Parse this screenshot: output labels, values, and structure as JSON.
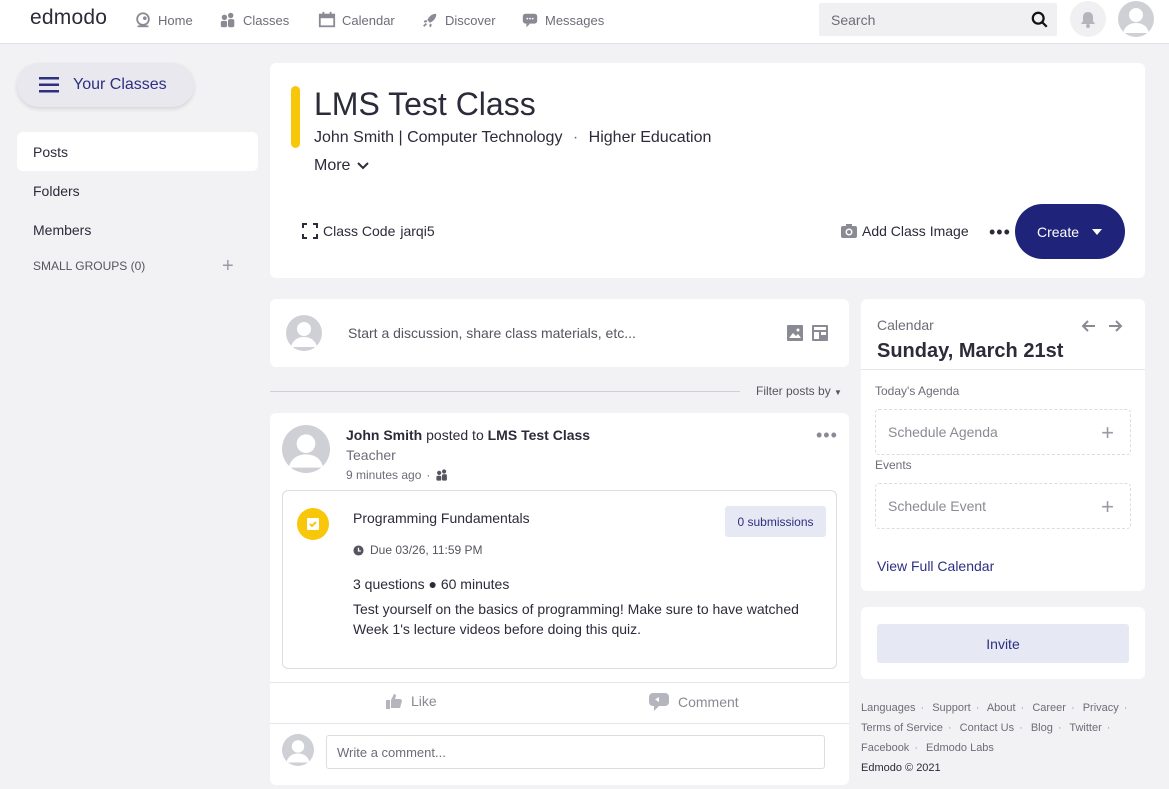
{
  "nav": {
    "logo": "edmodo",
    "items": [
      {
        "label": "Home",
        "icon": "home-icon"
      },
      {
        "label": "Classes",
        "icon": "classes-icon"
      },
      {
        "label": "Calendar",
        "icon": "calendar-icon"
      },
      {
        "label": "Discover",
        "icon": "rocket-icon"
      },
      {
        "label": "Messages",
        "icon": "messages-icon"
      }
    ],
    "search_placeholder": "Search"
  },
  "sidebar": {
    "your_classes": "Your Classes",
    "items": [
      {
        "label": "Posts",
        "active": true
      },
      {
        "label": "Folders"
      },
      {
        "label": "Members"
      }
    ],
    "small_groups": "SMALL GROUPS (0)"
  },
  "class": {
    "title": "LMS Test Class",
    "subtitle": "John Smith | Computer Technology",
    "level": "Higher Education",
    "more": "More",
    "code_label": "Class Code",
    "code": "jarqi5",
    "add_image": "Add Class Image",
    "create": "Create",
    "accent": "#f8c70a"
  },
  "compose": {
    "placeholder": "Start a discussion, share class materials, etc..."
  },
  "filter": "Filter posts by",
  "post": {
    "author": "John Smith",
    "posted_to": "posted to",
    "class": "LMS Test Class",
    "role": "Teacher",
    "time": "9 minutes ago",
    "quiz": {
      "title": "Programming Fundamentals",
      "submissions": "0 submissions",
      "due": "Due 03/26, 11:59 PM",
      "meta": "3 questions ● 60 minutes",
      "description": "Test yourself on the basics of programming! Make sure to have watched Week 1's lecture videos before doing this quiz."
    },
    "like": "Like",
    "comment": "Comment",
    "comment_placeholder": "Write a comment..."
  },
  "calendar": {
    "label": "Calendar",
    "date": "Sunday, March 21st",
    "agenda_label": "Today's Agenda",
    "schedule_agenda": "Schedule Agenda",
    "events_label": "Events",
    "schedule_event": "Schedule Event",
    "view_full": "View Full Calendar"
  },
  "invite": "Invite",
  "footer": {
    "links": [
      "Languages",
      "Support",
      "About",
      "Career",
      "Privacy",
      "Terms of Service",
      "Contact Us",
      "Blog",
      "Twitter",
      "Facebook",
      "Edmodo Labs"
    ],
    "copyright": "Edmodo © 2021"
  },
  "colors": {
    "brand_navy": "#1f247a",
    "link_blue": "#2e2f80",
    "accent_yellow": "#f8c70a"
  }
}
